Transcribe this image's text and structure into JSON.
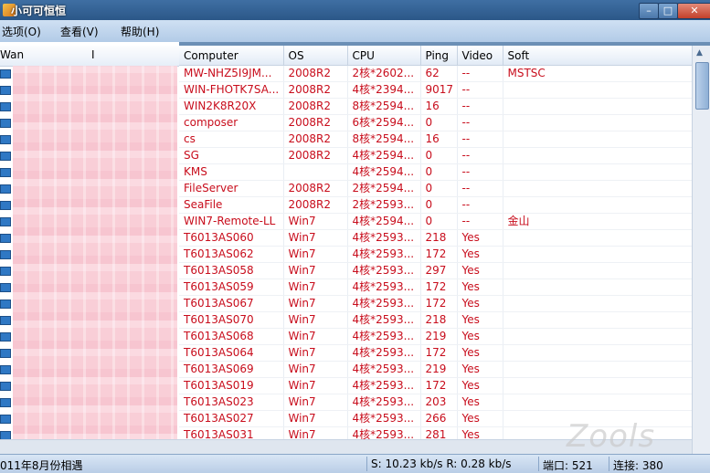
{
  "window": {
    "title": "小可可恒恒"
  },
  "menu": {
    "items": [
      "选项(O)",
      "查看(V)",
      "帮助(H)"
    ]
  },
  "left_panel": {
    "columns": [
      "Wan",
      "I"
    ]
  },
  "table": {
    "columns": [
      "Computer",
      "OS",
      "CPU",
      "Ping",
      "Video",
      "Soft"
    ],
    "rows": [
      [
        "MW-NHZ5I9JM...",
        "2008R2",
        "2核*2602...",
        "62",
        "--",
        "MSTSC"
      ],
      [
        "WIN-FHOTK7SA...",
        "2008R2",
        "4核*2394...",
        "9017",
        "--",
        ""
      ],
      [
        "WIN2K8R20X",
        "2008R2",
        "8核*2594...",
        "16",
        "--",
        ""
      ],
      [
        "composer",
        "2008R2",
        "6核*2594...",
        "0",
        "--",
        ""
      ],
      [
        "cs",
        "2008R2",
        "8核*2594...",
        "16",
        "--",
        ""
      ],
      [
        "SG",
        "2008R2",
        "4核*2594...",
        "0",
        "--",
        ""
      ],
      [
        "KMS",
        "",
        "4核*2594...",
        "0",
        "--",
        ""
      ],
      [
        "FileServer",
        "2008R2",
        "2核*2594...",
        "0",
        "--",
        ""
      ],
      [
        "SeaFile",
        "2008R2",
        "2核*2593...",
        "0",
        "--",
        ""
      ],
      [
        "WIN7-Remote-LL",
        "Win7",
        "4核*2594...",
        "0",
        "--",
        "金山"
      ],
      [
        "T6013AS060",
        "Win7",
        "4核*2593...",
        "218",
        "Yes",
        ""
      ],
      [
        "T6013AS062",
        "Win7",
        "4核*2593...",
        "172",
        "Yes",
        ""
      ],
      [
        "T6013AS058",
        "Win7",
        "4核*2593...",
        "297",
        "Yes",
        ""
      ],
      [
        "T6013AS059",
        "Win7",
        "4核*2593...",
        "172",
        "Yes",
        ""
      ],
      [
        "T6013AS067",
        "Win7",
        "4核*2593...",
        "172",
        "Yes",
        ""
      ],
      [
        "T6013AS070",
        "Win7",
        "4核*2593...",
        "218",
        "Yes",
        ""
      ],
      [
        "T6013AS068",
        "Win7",
        "4核*2593...",
        "219",
        "Yes",
        ""
      ],
      [
        "T6013AS064",
        "Win7",
        "4核*2593...",
        "172",
        "Yes",
        ""
      ],
      [
        "T6013AS069",
        "Win7",
        "4核*2593...",
        "219",
        "Yes",
        ""
      ],
      [
        "T6013AS019",
        "Win7",
        "4核*2593...",
        "172",
        "Yes",
        ""
      ],
      [
        "T6013AS023",
        "Win7",
        "4核*2593...",
        "203",
        "Yes",
        ""
      ],
      [
        "T6013AS027",
        "Win7",
        "4核*2593...",
        "266",
        "Yes",
        ""
      ],
      [
        "T6013AS031",
        "Win7",
        "4核*2593...",
        "281",
        "Yes",
        ""
      ]
    ]
  },
  "status": {
    "message": "011年8月份相遇",
    "speed": "S: 10.23 kb/s R: 0.28 kb/s",
    "port": "端口: 521",
    "connections": "连接: 380"
  },
  "watermark": "Zools",
  "colors": {
    "row_text": "#c80d1c",
    "title_bar": "#2b5788"
  }
}
